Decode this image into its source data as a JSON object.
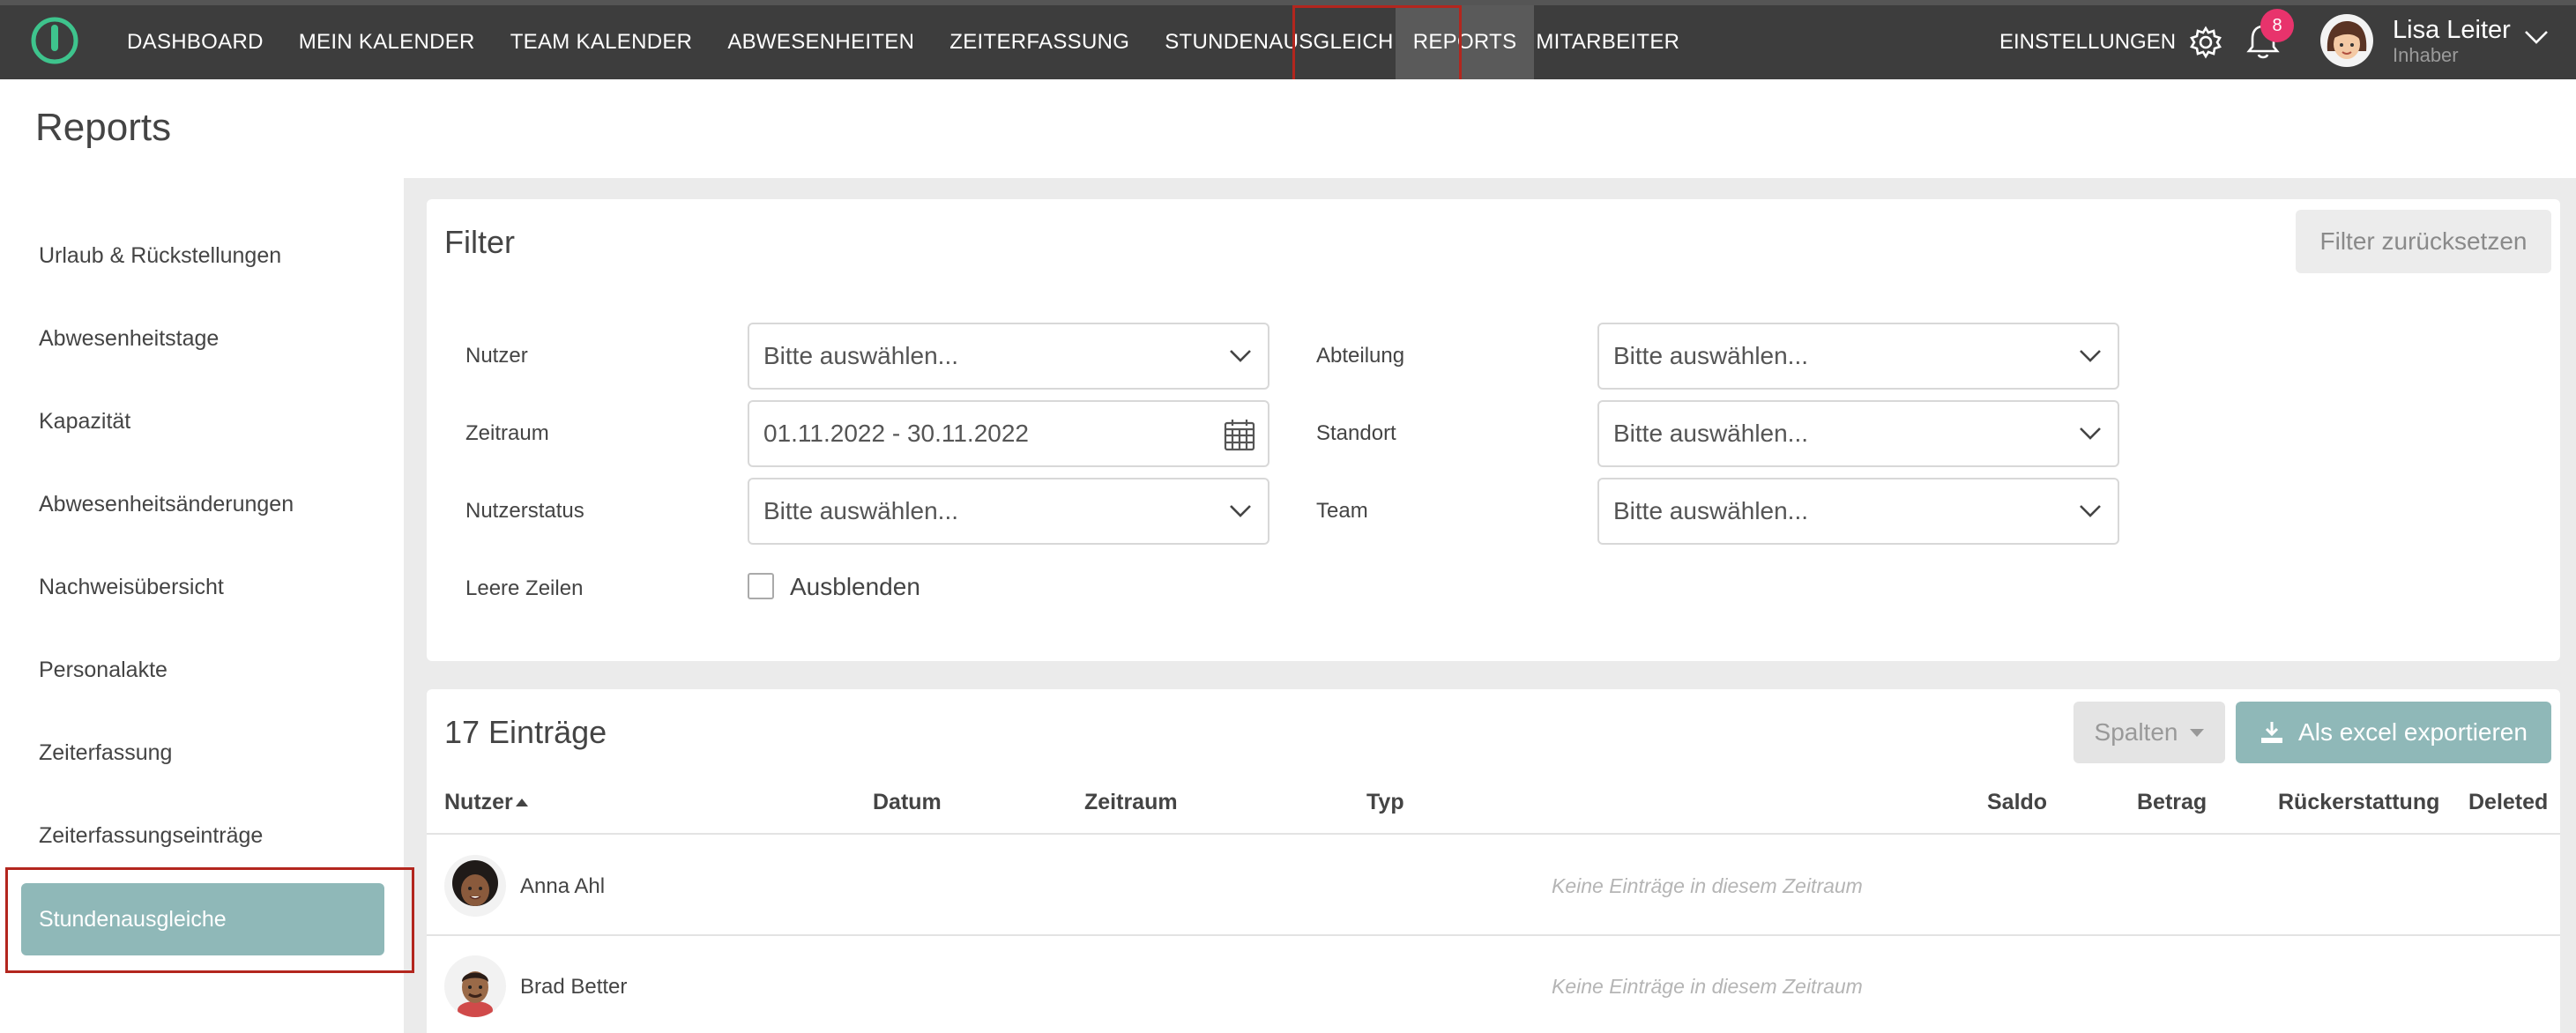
{
  "nav": {
    "items": [
      {
        "label": "DASHBOARD"
      },
      {
        "label": "MEIN KALENDER"
      },
      {
        "label": "TEAM KALENDER"
      },
      {
        "label": "ABWESENHEITEN"
      },
      {
        "label": "ZEITERFASSUNG"
      },
      {
        "label": "STUNDENAUSGLEICH"
      },
      {
        "label": "REPORTS"
      },
      {
        "label": "MITARBEITER"
      }
    ],
    "settings_label": "EINSTELLUNGEN",
    "notification_count": "8",
    "user": {
      "name": "Lisa Leiter",
      "role": "Inhaber"
    }
  },
  "page": {
    "title": "Reports"
  },
  "sidebar": {
    "items": [
      {
        "label": "Urlaub & Rückstellungen"
      },
      {
        "label": "Abwesenheitstage"
      },
      {
        "label": "Kapazität"
      },
      {
        "label": "Abwesenheitsänderungen"
      },
      {
        "label": "Nachweisübersicht"
      },
      {
        "label": "Personalakte"
      },
      {
        "label": "Zeiterfassung"
      },
      {
        "label": "Zeiterfassungseinträge"
      },
      {
        "label": "Stundenausgleiche"
      }
    ]
  },
  "filter": {
    "title": "Filter",
    "reset_label": "Filter zurücksetzen",
    "fields": {
      "nutzer": {
        "label": "Nutzer",
        "value": "Bitte auswählen..."
      },
      "zeitraum": {
        "label": "Zeitraum",
        "value": "01.11.2022 - 30.11.2022"
      },
      "nutzerstatus": {
        "label": "Nutzerstatus",
        "value": "Bitte auswählen..."
      },
      "leere_zeilen": {
        "label": "Leere Zeilen",
        "checkbox_label": "Ausblenden",
        "checked": false
      },
      "abteilung": {
        "label": "Abteilung",
        "value": "Bitte auswählen..."
      },
      "standort": {
        "label": "Standort",
        "value": "Bitte auswählen..."
      },
      "team": {
        "label": "Team",
        "value": "Bitte auswählen..."
      }
    }
  },
  "table": {
    "entries_title": "17 Einträge",
    "columns_label": "Spalten",
    "export_label": "Als excel exportieren",
    "headers": [
      "Nutzer",
      "Datum",
      "Zeitraum",
      "Typ",
      "Saldo",
      "Betrag",
      "Rückerstattung",
      "Deleted"
    ],
    "rows": [
      {
        "name": "Anna Ahl",
        "note": "Keine Einträge in diesem Zeitraum"
      },
      {
        "name": "Brad Better",
        "note": "Keine Einträge in diesem Zeitraum"
      }
    ]
  },
  "colors": {
    "nav_bg": "#3d3d3d",
    "accent": "#8fb8b8",
    "badge": "#e8336c",
    "logo_green": "#3ec48d",
    "highlight": "#b3261e"
  }
}
